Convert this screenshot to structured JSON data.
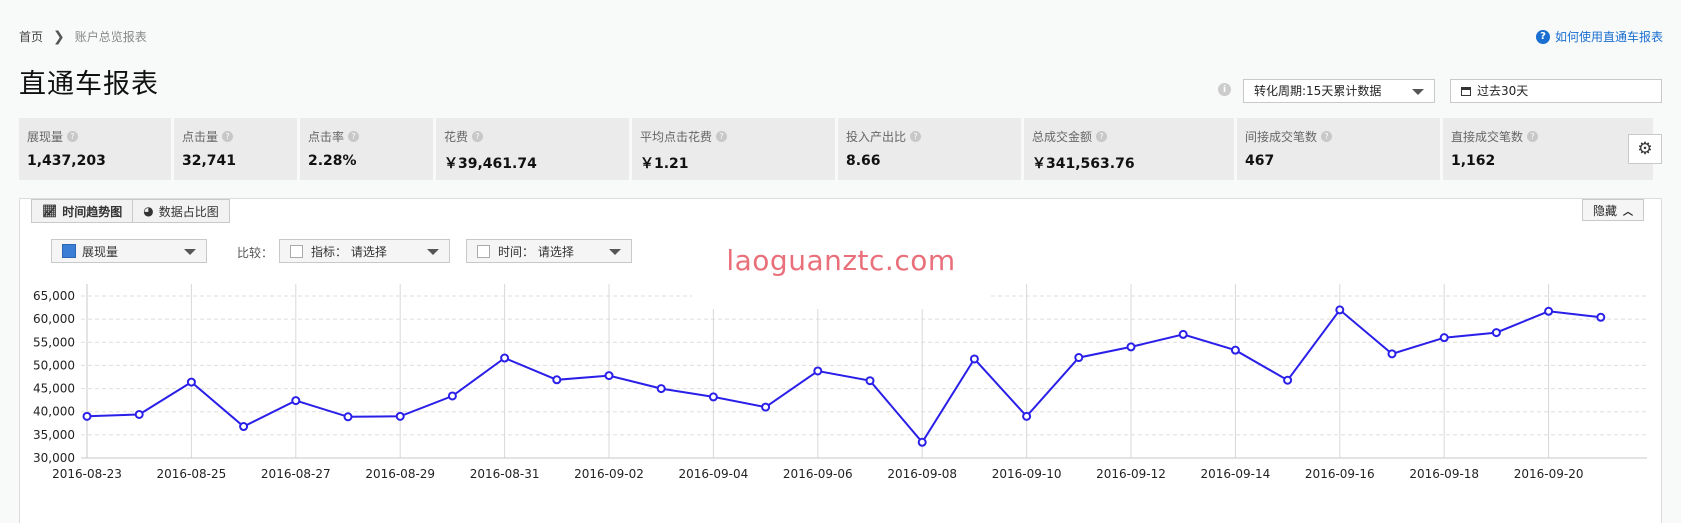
{
  "breadcrumb": {
    "home": "首页",
    "separator": "❯",
    "current": "账户总览报表"
  },
  "help": {
    "icon": "question-circle-icon",
    "label": "如何使用直通车报表"
  },
  "title": "直通车报表",
  "controls": {
    "info_icon": "info-icon",
    "period_select": "转化周期:15天累计数据",
    "date_range": "过去30天",
    "calendar_icon": "calendar-icon"
  },
  "metrics": [
    {
      "label": "展现量",
      "value": "1,437,203"
    },
    {
      "label": "点击量",
      "value": "32,741"
    },
    {
      "label": "点击率",
      "value": "2.28%"
    },
    {
      "label": "花费",
      "value": "￥39,461.74"
    },
    {
      "label": "平均点击花费",
      "value": "￥1.21"
    },
    {
      "label": "投入产出比",
      "value": "8.66"
    },
    {
      "label": "总成交金额",
      "value": "￥341,563.76"
    },
    {
      "label": "间接成交笔数",
      "value": "467"
    },
    {
      "label": "直接成交笔数",
      "value": "1,162"
    }
  ],
  "metric_help_glyph": "?",
  "settings_icon": "gear-icon",
  "chart_panel": {
    "tabs": [
      {
        "label": "时间趋势图",
        "icon": "line-chart-icon"
      },
      {
        "label": "数据占比图",
        "icon": "pie-chart-icon"
      }
    ],
    "hide_label": "隐藏",
    "metric_select": "展现量",
    "compare_label": "比较：",
    "compare_indicator": "指标： 请选择",
    "compare_time": "时间： 请选择",
    "watermark": "laoguanztc.com",
    "colors": {
      "line": "#2a1fe8",
      "swatch": "#3a7fd5"
    }
  },
  "chart_data": {
    "type": "line",
    "series": [
      {
        "name": "展现量",
        "x": [
          "2016-08-23",
          "2016-08-24",
          "2016-08-25",
          "2016-08-26",
          "2016-08-27",
          "2016-08-28",
          "2016-08-29",
          "2016-08-30",
          "2016-08-31",
          "2016-09-01",
          "2016-09-02",
          "2016-09-03",
          "2016-09-04",
          "2016-09-05",
          "2016-09-06",
          "2016-09-07",
          "2016-09-08",
          "2016-09-09",
          "2016-09-10",
          "2016-09-11",
          "2016-09-12",
          "2016-09-13",
          "2016-09-14",
          "2016-09-15",
          "2016-09-16",
          "2016-09-17",
          "2016-09-18",
          "2016-09-19",
          "2016-09-20",
          "2016-09-21"
        ],
        "values": [
          39000,
          39400,
          46400,
          36800,
          42400,
          38900,
          39000,
          43400,
          51600,
          46900,
          47800,
          45000,
          43200,
          41000,
          48800,
          46700,
          33400,
          51400,
          39000,
          51700,
          54000,
          56700,
          53300,
          46800,
          62000,
          52500,
          56000,
          57100,
          61700,
          60400
        ]
      }
    ],
    "x_tick_labels": [
      "2016-08-23",
      "2016-08-25",
      "2016-08-27",
      "2016-08-29",
      "2016-08-31",
      "2016-09-02",
      "2016-09-04",
      "2016-09-06",
      "2016-09-08",
      "2016-09-10",
      "2016-09-12",
      "2016-09-14",
      "2016-09-16",
      "2016-09-18",
      "2016-09-20"
    ],
    "y_tick_labels": [
      "30,000",
      "35,000",
      "40,000",
      "45,000",
      "50,000",
      "55,000",
      "60,000",
      "65,000"
    ],
    "ylim": [
      30000,
      65000
    ],
    "grid": true,
    "title": "",
    "xlabel": "",
    "ylabel": ""
  }
}
